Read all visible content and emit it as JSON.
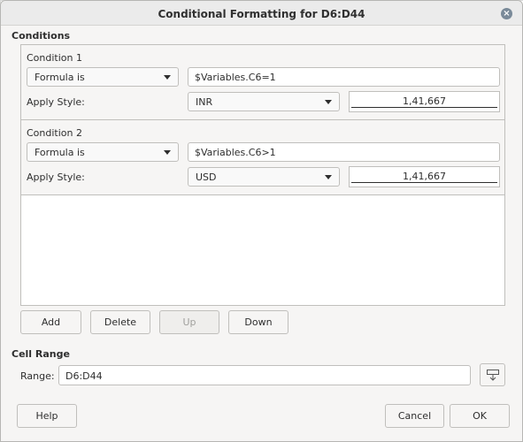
{
  "window": {
    "title": "Conditional Formatting for D6:D44"
  },
  "conditions_section": {
    "label": "Conditions"
  },
  "conditions": [
    {
      "title": "Condition 1",
      "type": "Formula is",
      "formula": "$Variables.C6=1",
      "apply_style_label": "Apply Style:",
      "style": "INR",
      "preview": "1,41,667"
    },
    {
      "title": "Condition 2",
      "type": "Formula is",
      "formula": "$Variables.C6>1",
      "apply_style_label": "Apply Style:",
      "style": "USD",
      "preview": "1,41,667"
    }
  ],
  "list_buttons": {
    "add": "Add",
    "delete": "Delete",
    "up": "Up",
    "down": "Down"
  },
  "cell_range": {
    "section_label": "Cell Range",
    "range_label": "Range:",
    "value": "D6:D44"
  },
  "footer": {
    "help": "Help",
    "cancel": "Cancel",
    "ok": "OK"
  }
}
